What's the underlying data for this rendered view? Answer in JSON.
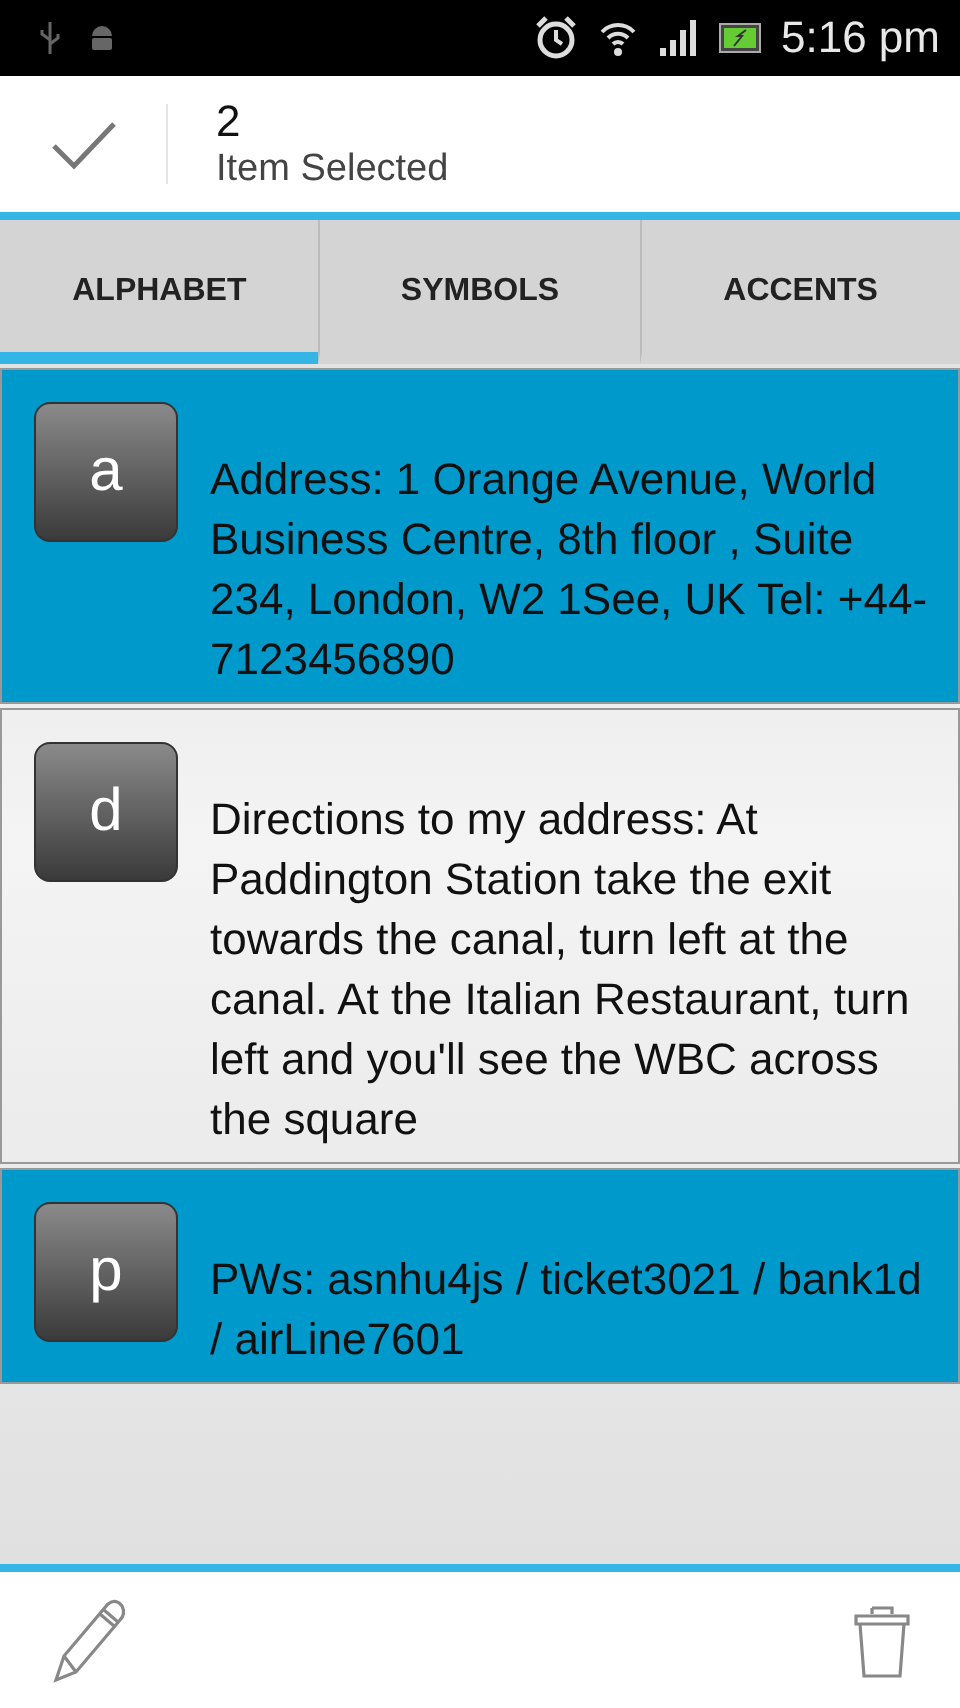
{
  "status_bar": {
    "time": "5:16 pm"
  },
  "action_bar": {
    "count": "2",
    "subtitle": "Item Selected"
  },
  "tabs": [
    {
      "label": "ALPHABET",
      "selected": true
    },
    {
      "label": "SYMBOLS",
      "selected": false
    },
    {
      "label": "ACCENTS",
      "selected": false
    }
  ],
  "items": [
    {
      "key": "a",
      "text": "Address: 1 Orange Avenue, World Business Centre, 8th floor , Suite 234, London, W2 1See, UK Tel: +44-7123456890",
      "selected": true
    },
    {
      "key": "d",
      "text": "Directions to my address: At Paddington Station take the exit towards the canal, turn left at the canal. At the Italian Restaurant, turn left and you'll see the WBC across the square",
      "selected": false
    },
    {
      "key": "p",
      "text": "PWs: asnhu4js / ticket3021 / bank1d / airLine7601",
      "selected": true
    }
  ]
}
